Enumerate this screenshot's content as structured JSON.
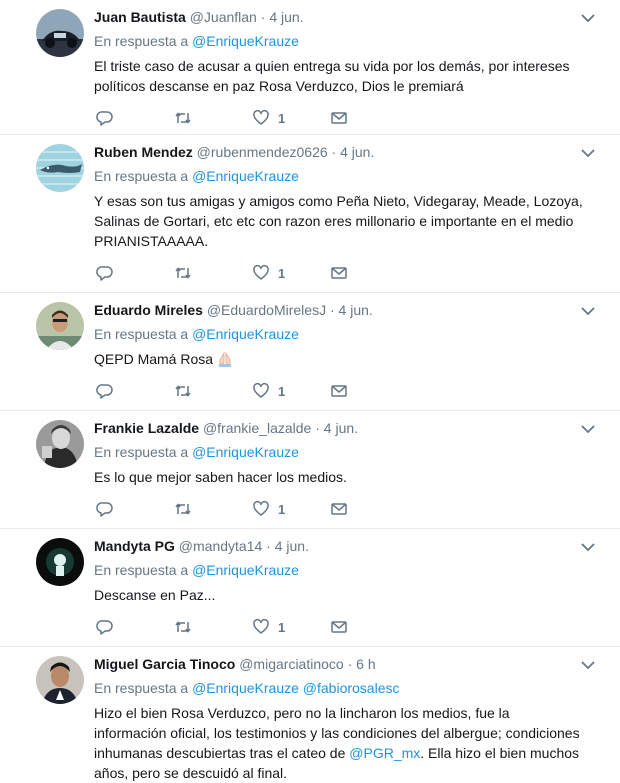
{
  "tweets": [
    {
      "name": "Juan Bautista",
      "handle": "@Juanflan",
      "time": "4 jun.",
      "reply_prefix": "En respuesta a",
      "mentions": [
        "@EnriqueKrauze"
      ],
      "text": "El triste caso de acusar a quien entrega su vida por los demás, por intereses políticos descanse en paz Rosa Verduzco, Dios le premiará",
      "likes": "1"
    },
    {
      "name": "Ruben Mendez",
      "handle": "@rubenmendez0626",
      "time": "4 jun.",
      "reply_prefix": "En respuesta a",
      "mentions": [
        "@EnriqueKrauze"
      ],
      "text": "Y esas son  tus amigas y amigos como Peña Nieto, Videgaray, Meade, Lozoya, Salinas de Gortari, etc etc con razon eres millonario e importante en el medio PRIANISTAAAAA.",
      "likes": "1"
    },
    {
      "name": "Eduardo Mireles",
      "handle": "@EduardoMirelesJ",
      "time": "4 jun.",
      "reply_prefix": "En respuesta a",
      "mentions": [
        "@EnriqueKrauze"
      ],
      "text": "QEPD Mamá Rosa",
      "likes": "1"
    },
    {
      "name": "Frankie Lazalde",
      "handle": "@frankie_lazalde",
      "time": "4 jun.",
      "reply_prefix": "En respuesta a",
      "mentions": [
        "@EnriqueKrauze"
      ],
      "text": "Es lo que mejor saben hacer los medios.",
      "likes": "1"
    },
    {
      "name": "Mandyta PG",
      "handle": "@mandyta14",
      "time": "4 jun.",
      "reply_prefix": "En respuesta a",
      "mentions": [
        "@EnriqueKrauze"
      ],
      "text": "Descanse en Paz...",
      "likes": "1"
    },
    {
      "name": "Miguel Garcia Tinoco",
      "handle": "@migarciatinoco",
      "time": "6 h",
      "reply_prefix": "En respuesta a",
      "mentions": [
        "@EnriqueKrauze",
        "@fabiorosalesc"
      ],
      "text_before_link": "Hizo el bien Rosa Verduzco, pero no la lincharon los medios, fue la información oficial, los testimonios y las condiciones del albergue; condiciones inhumanas descubiertas tras el cateo de ",
      "text_link": "@PGR_mx",
      "text_after_link": ". Ella hizo el bien muchos años, pero se descuidó al final.",
      "likes": ""
    }
  ],
  "separator": "·",
  "colors": {
    "link": "#1b95e0",
    "meta": "#657786",
    "divider": "#e6ecf0"
  },
  "icons": {
    "reply": "reply-icon",
    "retweet": "retweet-icon",
    "like": "heart-icon",
    "dm": "envelope-icon",
    "caret": "chevron-down-icon",
    "emoji": "praying-hands-emoji"
  }
}
